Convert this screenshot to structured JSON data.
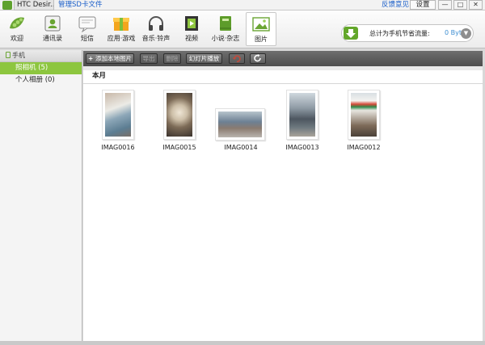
{
  "titlebar": {
    "device_tab": "HTC Desir...",
    "manage_sd": "管理SD卡文件",
    "feedback": "反馈意见",
    "settings": "设置",
    "minimize": "—",
    "maximize": "□",
    "close": "✕"
  },
  "nav": [
    {
      "label": "欢迎",
      "icon": "pea-pod-icon"
    },
    {
      "label": "通讯录",
      "icon": "contacts-icon"
    },
    {
      "label": "短信",
      "icon": "sms-icon"
    },
    {
      "label": "应用·游戏",
      "icon": "app-box-icon"
    },
    {
      "label": "音乐·铃声",
      "icon": "headphones-icon"
    },
    {
      "label": "视频",
      "icon": "film-icon"
    },
    {
      "label": "小说·杂志",
      "icon": "book-icon"
    },
    {
      "label": "图片",
      "icon": "picture-icon"
    }
  ],
  "traffic": {
    "label": "总计为手机节省流量:",
    "value": "0 Bytes",
    "accent": "#3f8fd2"
  },
  "sidebar": {
    "header": "手机",
    "items": [
      {
        "label": "照相机 (5)"
      },
      {
        "label": "个人相册 (0)"
      }
    ]
  },
  "actions": {
    "add_local": "添加本地图片",
    "export": "导出",
    "delete": "删除",
    "slideshow": "幻灯片播放"
  },
  "content": {
    "group_title": "本月",
    "photos": [
      {
        "name": "IMAG0016"
      },
      {
        "name": "IMAG0015"
      },
      {
        "name": "IMAG0014"
      },
      {
        "name": "IMAG0013"
      },
      {
        "name": "IMAG0012"
      }
    ]
  },
  "colors": {
    "brand_green": "#6aa533",
    "selected_green": "#8dc63f",
    "link_blue": "#1a5ec9"
  }
}
